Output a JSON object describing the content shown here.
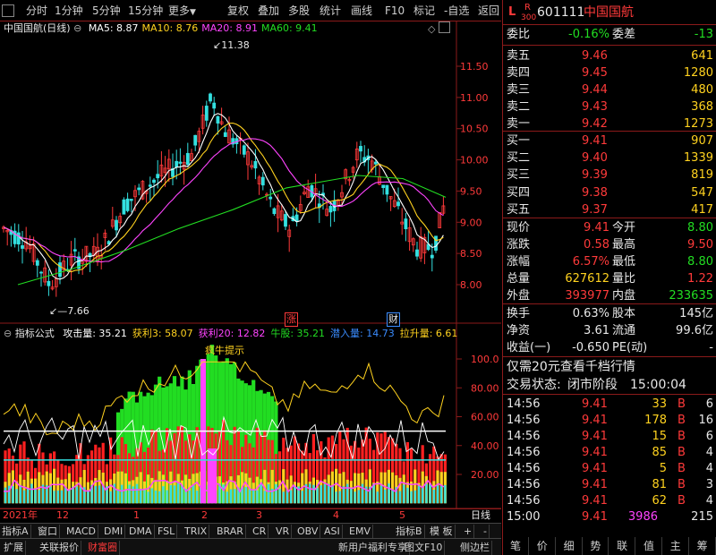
{
  "toolbar": {
    "items": [
      "分时",
      "1分钟",
      "5分钟",
      "15分钟",
      "更多",
      "复权",
      "叠加",
      "多股",
      "统计",
      "画线",
      "F10",
      "标记",
      "-自选",
      "返回"
    ]
  },
  "kline": {
    "title": "中国国航(日线)",
    "ma": [
      {
        "label": "MA5: 8.87",
        "color": "#ffffff"
      },
      {
        "label": "MA10: 8.76",
        "color": "#ffd21f"
      },
      {
        "label": "MA20: 8.91",
        "color": "#ff44ff"
      },
      {
        "label": "MA60: 9.41",
        "color": "#22dd22"
      }
    ],
    "price_axis": [
      "11.50",
      "11.00",
      "10.50",
      "10.00",
      "9.50",
      "9.00",
      "8.50",
      "8.00"
    ],
    "high_label": "11.38",
    "low_label": "7.66",
    "markers": [
      "涨",
      "财"
    ]
  },
  "indicator": {
    "name": "指标公式",
    "items": [
      {
        "label": "攻击量: 35.21",
        "color": "#ffffff"
      },
      {
        "label": "获利3: 58.07",
        "color": "#ffd21f"
      },
      {
        "label": "获利20: 12.82",
        "color": "#ff44ff"
      },
      {
        "label": "牛股: 35.21",
        "color": "#22dd22"
      },
      {
        "label": "潜入量: 14.73",
        "color": "#3a8cff"
      },
      {
        "label": "拉升量: 6.61",
        "color": "#ffd21f"
      }
    ],
    "hint": "疯牛提示",
    "axis": [
      "100.0",
      "80.00",
      "60.00",
      "40.00",
      "20.00"
    ]
  },
  "time_axis": {
    "labels": [
      "2021年",
      "12",
      "1",
      "2",
      "3",
      "4",
      "5"
    ],
    "right": "日线"
  },
  "tabs1": [
    "指标A",
    "窗口",
    "MACD",
    "DMI",
    "DMA",
    "FSL",
    "TRIX",
    "BRAR",
    "CR",
    "VR",
    "OBV",
    "ASI",
    "EMV",
    "指标B",
    "模 板",
    "+",
    "-"
  ],
  "tabs2": [
    "扩展",
    "关联报价",
    "财富圈",
    "新用户福利专享",
    "图文F10",
    "侧边栏"
  ],
  "quote": {
    "market_l": "L",
    "market_r": "R",
    "market_num": "300",
    "code": "601111",
    "name": "中国国航",
    "weibi_label": "委比",
    "weibi": "-0.16%",
    "weicha_label": "委差",
    "weicha": "-13",
    "sell": [
      {
        "label": "卖五",
        "price": "9.46",
        "vol": "641"
      },
      {
        "label": "卖四",
        "price": "9.45",
        "vol": "1280"
      },
      {
        "label": "卖三",
        "price": "9.44",
        "vol": "480"
      },
      {
        "label": "卖二",
        "price": "9.43",
        "vol": "368"
      },
      {
        "label": "卖一",
        "price": "9.42",
        "vol": "1273"
      }
    ],
    "buy": [
      {
        "label": "买一",
        "price": "9.41",
        "vol": "907"
      },
      {
        "label": "买二",
        "price": "9.40",
        "vol": "1339"
      },
      {
        "label": "买三",
        "price": "9.39",
        "vol": "819"
      },
      {
        "label": "买四",
        "price": "9.38",
        "vol": "547"
      },
      {
        "label": "买五",
        "price": "9.37",
        "vol": "417"
      }
    ],
    "stats": [
      {
        "l1": "现价",
        "v1": "9.41",
        "c1": "red",
        "l2": "今开",
        "v2": "8.80",
        "c2": "green"
      },
      {
        "l1": "涨跌",
        "v1": "0.58",
        "c1": "red",
        "l2": "最高",
        "v2": "9.50",
        "c2": "red"
      },
      {
        "l1": "涨幅",
        "v1": "6.57%",
        "c1": "red",
        "l2": "最低",
        "v2": "8.80",
        "c2": "green"
      },
      {
        "l1": "总量",
        "v1": "627612",
        "c1": "yellow",
        "l2": "量比",
        "v2": "1.22",
        "c2": "red"
      },
      {
        "l1": "外盘",
        "v1": "393977",
        "c1": "red",
        "l2": "内盘",
        "v2": "233635",
        "c2": "green"
      }
    ],
    "stats2": [
      {
        "l1": "换手",
        "v1": "0.63%",
        "l2": "股本",
        "v2": "145亿"
      },
      {
        "l1": "净资",
        "v1": "3.61",
        "l2": "流通",
        "v2": "99.6亿"
      },
      {
        "l1": "收益(一)",
        "v1": "-0.650",
        "l2": "PE(动)",
        "v2": "-"
      }
    ],
    "promo": "仅需20元查看千档行情",
    "status_label": "交易状态:",
    "status": "闭市阶段",
    "status_time": "15:00:04",
    "ticks": [
      {
        "time": "14:56",
        "price": "9.41",
        "vol": "33",
        "dir": "B",
        "n": "6"
      },
      {
        "time": "14:56",
        "price": "9.41",
        "vol": "178",
        "dir": "B",
        "n": "16"
      },
      {
        "time": "14:56",
        "price": "9.41",
        "vol": "15",
        "dir": "B",
        "n": "6"
      },
      {
        "time": "14:56",
        "price": "9.41",
        "vol": "85",
        "dir": "B",
        "n": "4"
      },
      {
        "time": "14:56",
        "price": "9.41",
        "vol": "5",
        "dir": "B",
        "n": "4"
      },
      {
        "time": "14:56",
        "price": "9.41",
        "vol": "81",
        "dir": "B",
        "n": "3"
      },
      {
        "time": "14:56",
        "price": "9.41",
        "vol": "62",
        "dir": "B",
        "n": "4"
      },
      {
        "time": "15:00",
        "price": "9.41",
        "vol": "3986",
        "dir": "",
        "n": "215"
      }
    ],
    "bottom_tabs": [
      "笔",
      "价",
      "细",
      "势",
      "联",
      "值",
      "主",
      "筹"
    ]
  },
  "colors": {
    "up": "#ff3a3a",
    "down": "#33e0e0",
    "frame": "#8b1a1a"
  }
}
